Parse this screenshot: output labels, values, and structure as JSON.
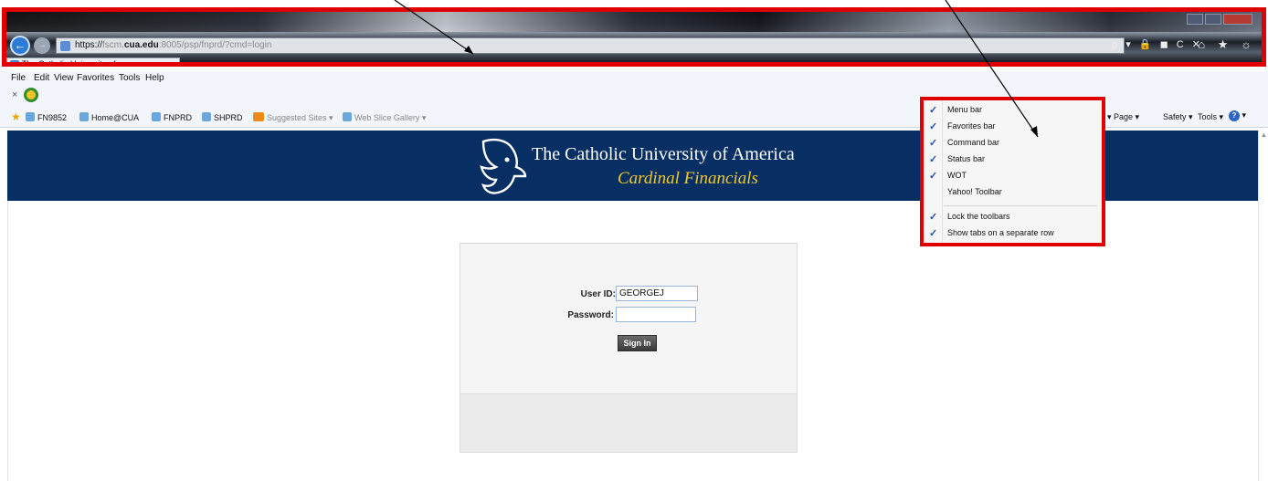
{
  "browser": {
    "url_scheme": "https://",
    "url_host_sub": "fscm.",
    "url_domain": "cua.edu",
    "url_rest": ":8005/psp/fnprd/?cmd=login",
    "tab_title": "The Catholic University of ...",
    "tab_close": "×",
    "back": "←",
    "forward": "→",
    "address_tools": "ρ ▾ 🔒 ◼ C ✕",
    "nav_icons": "⌂ ★ ☼"
  },
  "menubar": {
    "file": "File",
    "edit": "Edit",
    "view": "View",
    "favorites": "Favorites",
    "tools": "Tools",
    "help": "Help"
  },
  "iconrow": {
    "close": "×"
  },
  "favorites_bar": {
    "items": [
      "FN9852",
      "Home@CUA",
      "FNPRD",
      "SHPRD",
      "Suggested Sites ▾",
      "Web Slice Gallery ▾"
    ]
  },
  "command_bar": {
    "page": "▾  Page ▾",
    "safety": "Safety ▾",
    "tools": "Tools ▾",
    "help_glyph": "?",
    "help_arrow": "▾"
  },
  "banner": {
    "title": "The Catholic University of America",
    "subtitle": "Cardinal Financials"
  },
  "login": {
    "user_label": "User ID:",
    "user_value": "GEORGEJ",
    "password_label": "Password:",
    "password_value": "",
    "signin_label": "Sign In"
  },
  "toolbar_menu": {
    "check": "✓",
    "items": [
      {
        "label": "Menu bar",
        "checked": true
      },
      {
        "label": "Favorites bar",
        "checked": true
      },
      {
        "label": "Command bar",
        "checked": true
      },
      {
        "label": "Status bar",
        "checked": true
      },
      {
        "label": "WOT",
        "checked": true
      },
      {
        "label": "Yahoo! Toolbar",
        "checked": false
      },
      {
        "label": "Lock the toolbars",
        "checked": true
      },
      {
        "label": "Show tabs on a separate row",
        "checked": true
      }
    ]
  },
  "colors": {
    "highlight": "#e00000",
    "banner_bg": "#072f63",
    "banner_subtitle": "#efc92c"
  }
}
